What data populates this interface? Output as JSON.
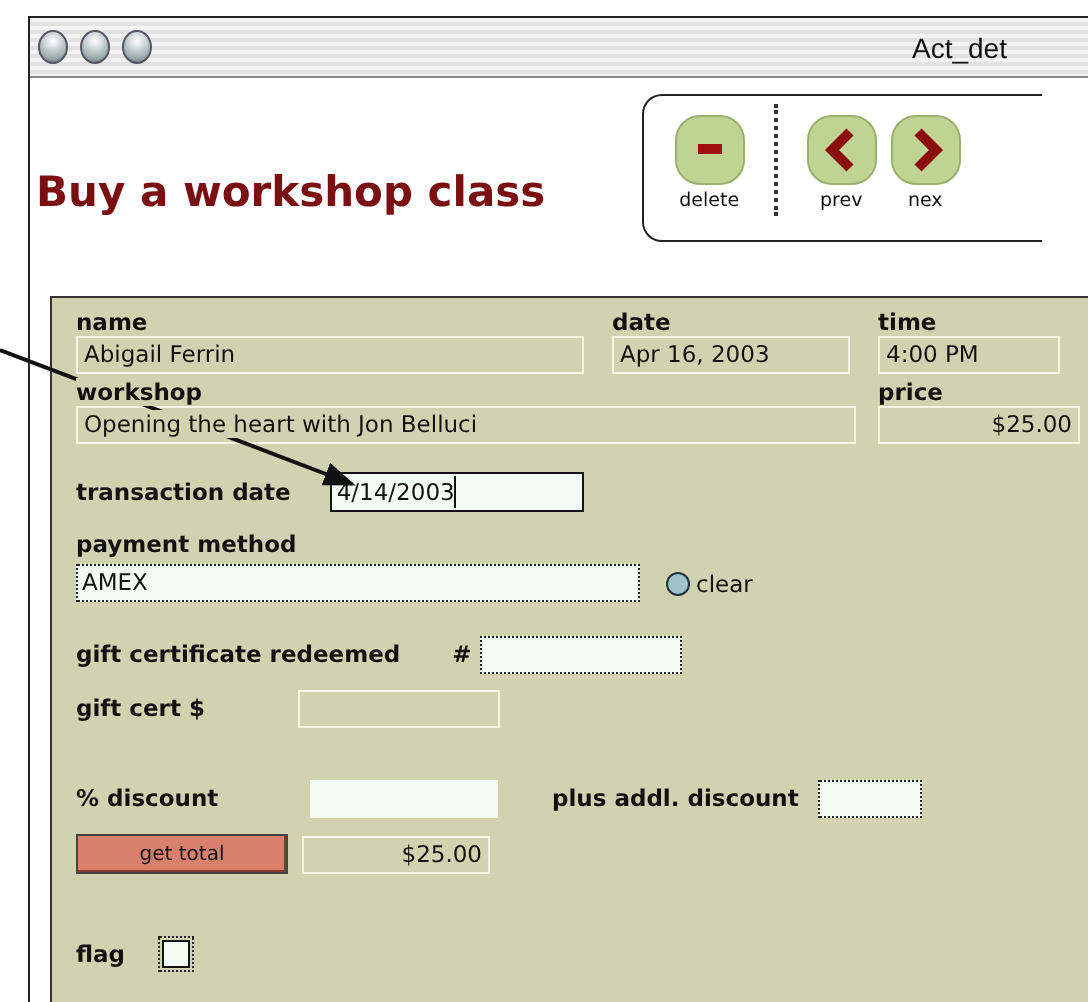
{
  "window": {
    "title": "Act_det"
  },
  "header": {
    "title": "Buy a workshop class"
  },
  "toolbar": {
    "buttons": [
      {
        "label": "delete",
        "kind": "delete"
      },
      {
        "label": "prev",
        "kind": "prev"
      },
      {
        "label": "nex",
        "kind": "next"
      }
    ]
  },
  "form": {
    "name": {
      "label": "name",
      "value": "Abigail Ferrin"
    },
    "date": {
      "label": "date",
      "value": "Apr 16, 2003"
    },
    "time": {
      "label": "time",
      "value": "4:00 PM"
    },
    "workshop": {
      "label": "workshop",
      "value": "Opening the heart with Jon Belluci"
    },
    "price": {
      "label": "price",
      "value": "$25.00"
    },
    "transaction_date": {
      "label": "transaction date",
      "value": "4/14/2003"
    },
    "payment_method": {
      "label": "payment method",
      "value": "AMEX",
      "clear_label": "clear"
    },
    "gift_certificate": {
      "label": "gift certificate redeemed",
      "number_label": "#"
    },
    "gift_cert_amount": {
      "label": "gift cert $"
    },
    "discount": {
      "label": "% discount",
      "extra_label": "plus addl. discount"
    },
    "total": {
      "button": "get total",
      "value": "$25.00"
    },
    "flag": {
      "label": "flag",
      "checked": false
    }
  }
}
